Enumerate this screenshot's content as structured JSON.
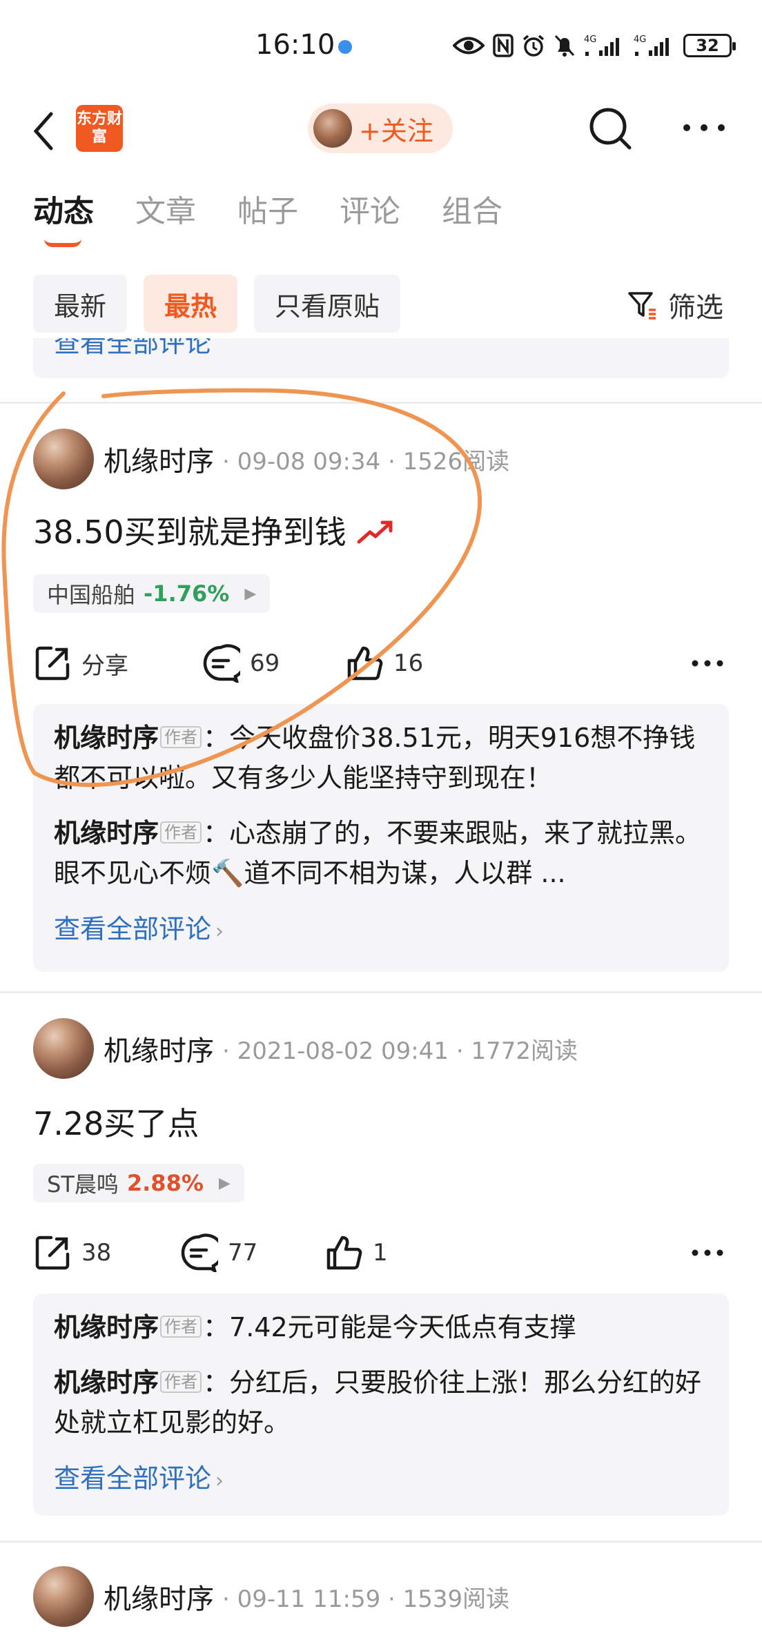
{
  "status_bar": {
    "time": "16:10",
    "battery": "32",
    "net1": "4G",
    "net2": "4G"
  },
  "nav": {
    "logo_text": "东方财富",
    "follow_label": "+关注"
  },
  "tabs": [
    {
      "label": "动态"
    },
    {
      "label": "文章"
    },
    {
      "label": "帖子"
    },
    {
      "label": "评论"
    },
    {
      "label": "组合"
    }
  ],
  "filters": {
    "chips": [
      {
        "label": "最新"
      },
      {
        "label": "最热"
      },
      {
        "label": "只看原贴"
      }
    ],
    "filter_label": "筛选"
  },
  "prev_card": {
    "view_all": "查看全部评论"
  },
  "posts": [
    {
      "author": "机缘时序",
      "time": "09-08 09:34",
      "reads": "1526阅读",
      "body": "38.50买到就是挣到钱",
      "stock": {
        "name": "中国船舶",
        "change": "-1.76%"
      },
      "share_label": "分享",
      "comments": "69",
      "likes": "16",
      "replies": [
        {
          "author": "机缘时序",
          "badge": "作者",
          "text": "今天收盘价38.51元，明天916想不挣钱都不可以啦。又有多少人能坚持守到现在！"
        },
        {
          "author": "机缘时序",
          "badge": "作者",
          "text": "心态崩了的，不要来跟贴，来了就拉黑。眼不见心不烦🔨道不同不相为谋，人以群 ..."
        }
      ],
      "view_all": "查看全部评论"
    },
    {
      "author": "机缘时序",
      "time": "2021-08-02 09:41",
      "reads": "1772阅读",
      "body": "7.28买了点",
      "stock": {
        "name": "ST晨鸣",
        "change": "2.88%"
      },
      "shares": "38",
      "comments": "77",
      "likes": "1",
      "replies": [
        {
          "author": "机缘时序",
          "badge": "作者",
          "text": "7.42元可能是今天低点有支撑"
        },
        {
          "author": "机缘时序",
          "badge": "作者",
          "text": "分红后，只要股价往上涨！那么分红的好处就立杠见影的好。"
        }
      ],
      "view_all": "查看全部评论"
    },
    {
      "author": "机缘时序",
      "time": "09-11 11:59",
      "reads": "1539阅读"
    }
  ],
  "colors": {
    "accent": "#f05a22",
    "link": "#2f6fbf",
    "down": "#2ea05a",
    "up": "#e0502a",
    "annotation": "#ef9551"
  }
}
